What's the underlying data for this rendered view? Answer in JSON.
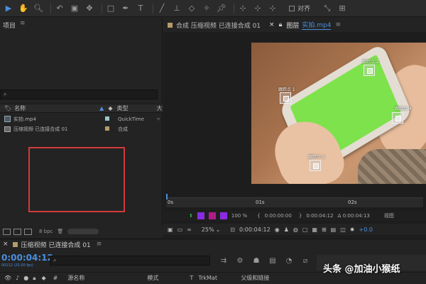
{
  "toolbar": {
    "icons": [
      "selection-tool",
      "hand-tool",
      "zoom-tool",
      "rotate-tool",
      "camera-tool",
      "pan-behind-tool",
      "rectangle-tool",
      "pen-tool",
      "type-tool",
      "brush-tool",
      "clone-stamp-tool",
      "eraser-tool",
      "roto-brush-tool",
      "puppet-tool"
    ],
    "snap_label": "对齐"
  },
  "project": {
    "title": "项目",
    "menu": "≡",
    "search_icon": "⌕",
    "columns": {
      "name": "名称",
      "type": "类型",
      "more": "大"
    },
    "items": [
      {
        "name": "实拍.mp4",
        "type": "QuickTime",
        "swatch": "#9ec6c9"
      },
      {
        "name": "压缩视频 已连接合成 01",
        "type": "合成",
        "swatch": "#b59b6b"
      }
    ],
    "footer": {
      "bpc": "8 bpc"
    }
  },
  "viewer": {
    "tabs": [
      {
        "label": "合成 压缩视频 已连接合成 01",
        "swatch": "#b59b6b"
      },
      {
        "label": "图层",
        "file": "实拍.mp4"
      }
    ],
    "trackers": [
      {
        "label": "跟踪点 1"
      },
      {
        "label": "跟踪点 2"
      },
      {
        "label": "跟踪点 3"
      },
      {
        "label": "跟踪点 4"
      }
    ],
    "ruler": {
      "start": "0s",
      "mid": "01s",
      "end": "02s"
    },
    "ctrl1": {
      "pct": "100 %",
      "t1": "0:00:00:00",
      "t2": "0:00:04:12",
      "t3": "Δ 0:00:04:13",
      "view": "视图"
    },
    "ctrl2": {
      "zoom": "25%",
      "time": "0:00:04:12",
      "exposure": "+0.0"
    }
  },
  "timeline": {
    "tab_label": "压缩视频 已连接合成 01",
    "current_time": "0:00:04:12",
    "frames": "00112 (25.00 fps)",
    "columns": {
      "source": "源名称",
      "mode": "模式",
      "t": "T",
      "trkmat": "TrkMat",
      "parent": "父级和链接"
    }
  },
  "watermark": "头条 @加油小猴纸"
}
